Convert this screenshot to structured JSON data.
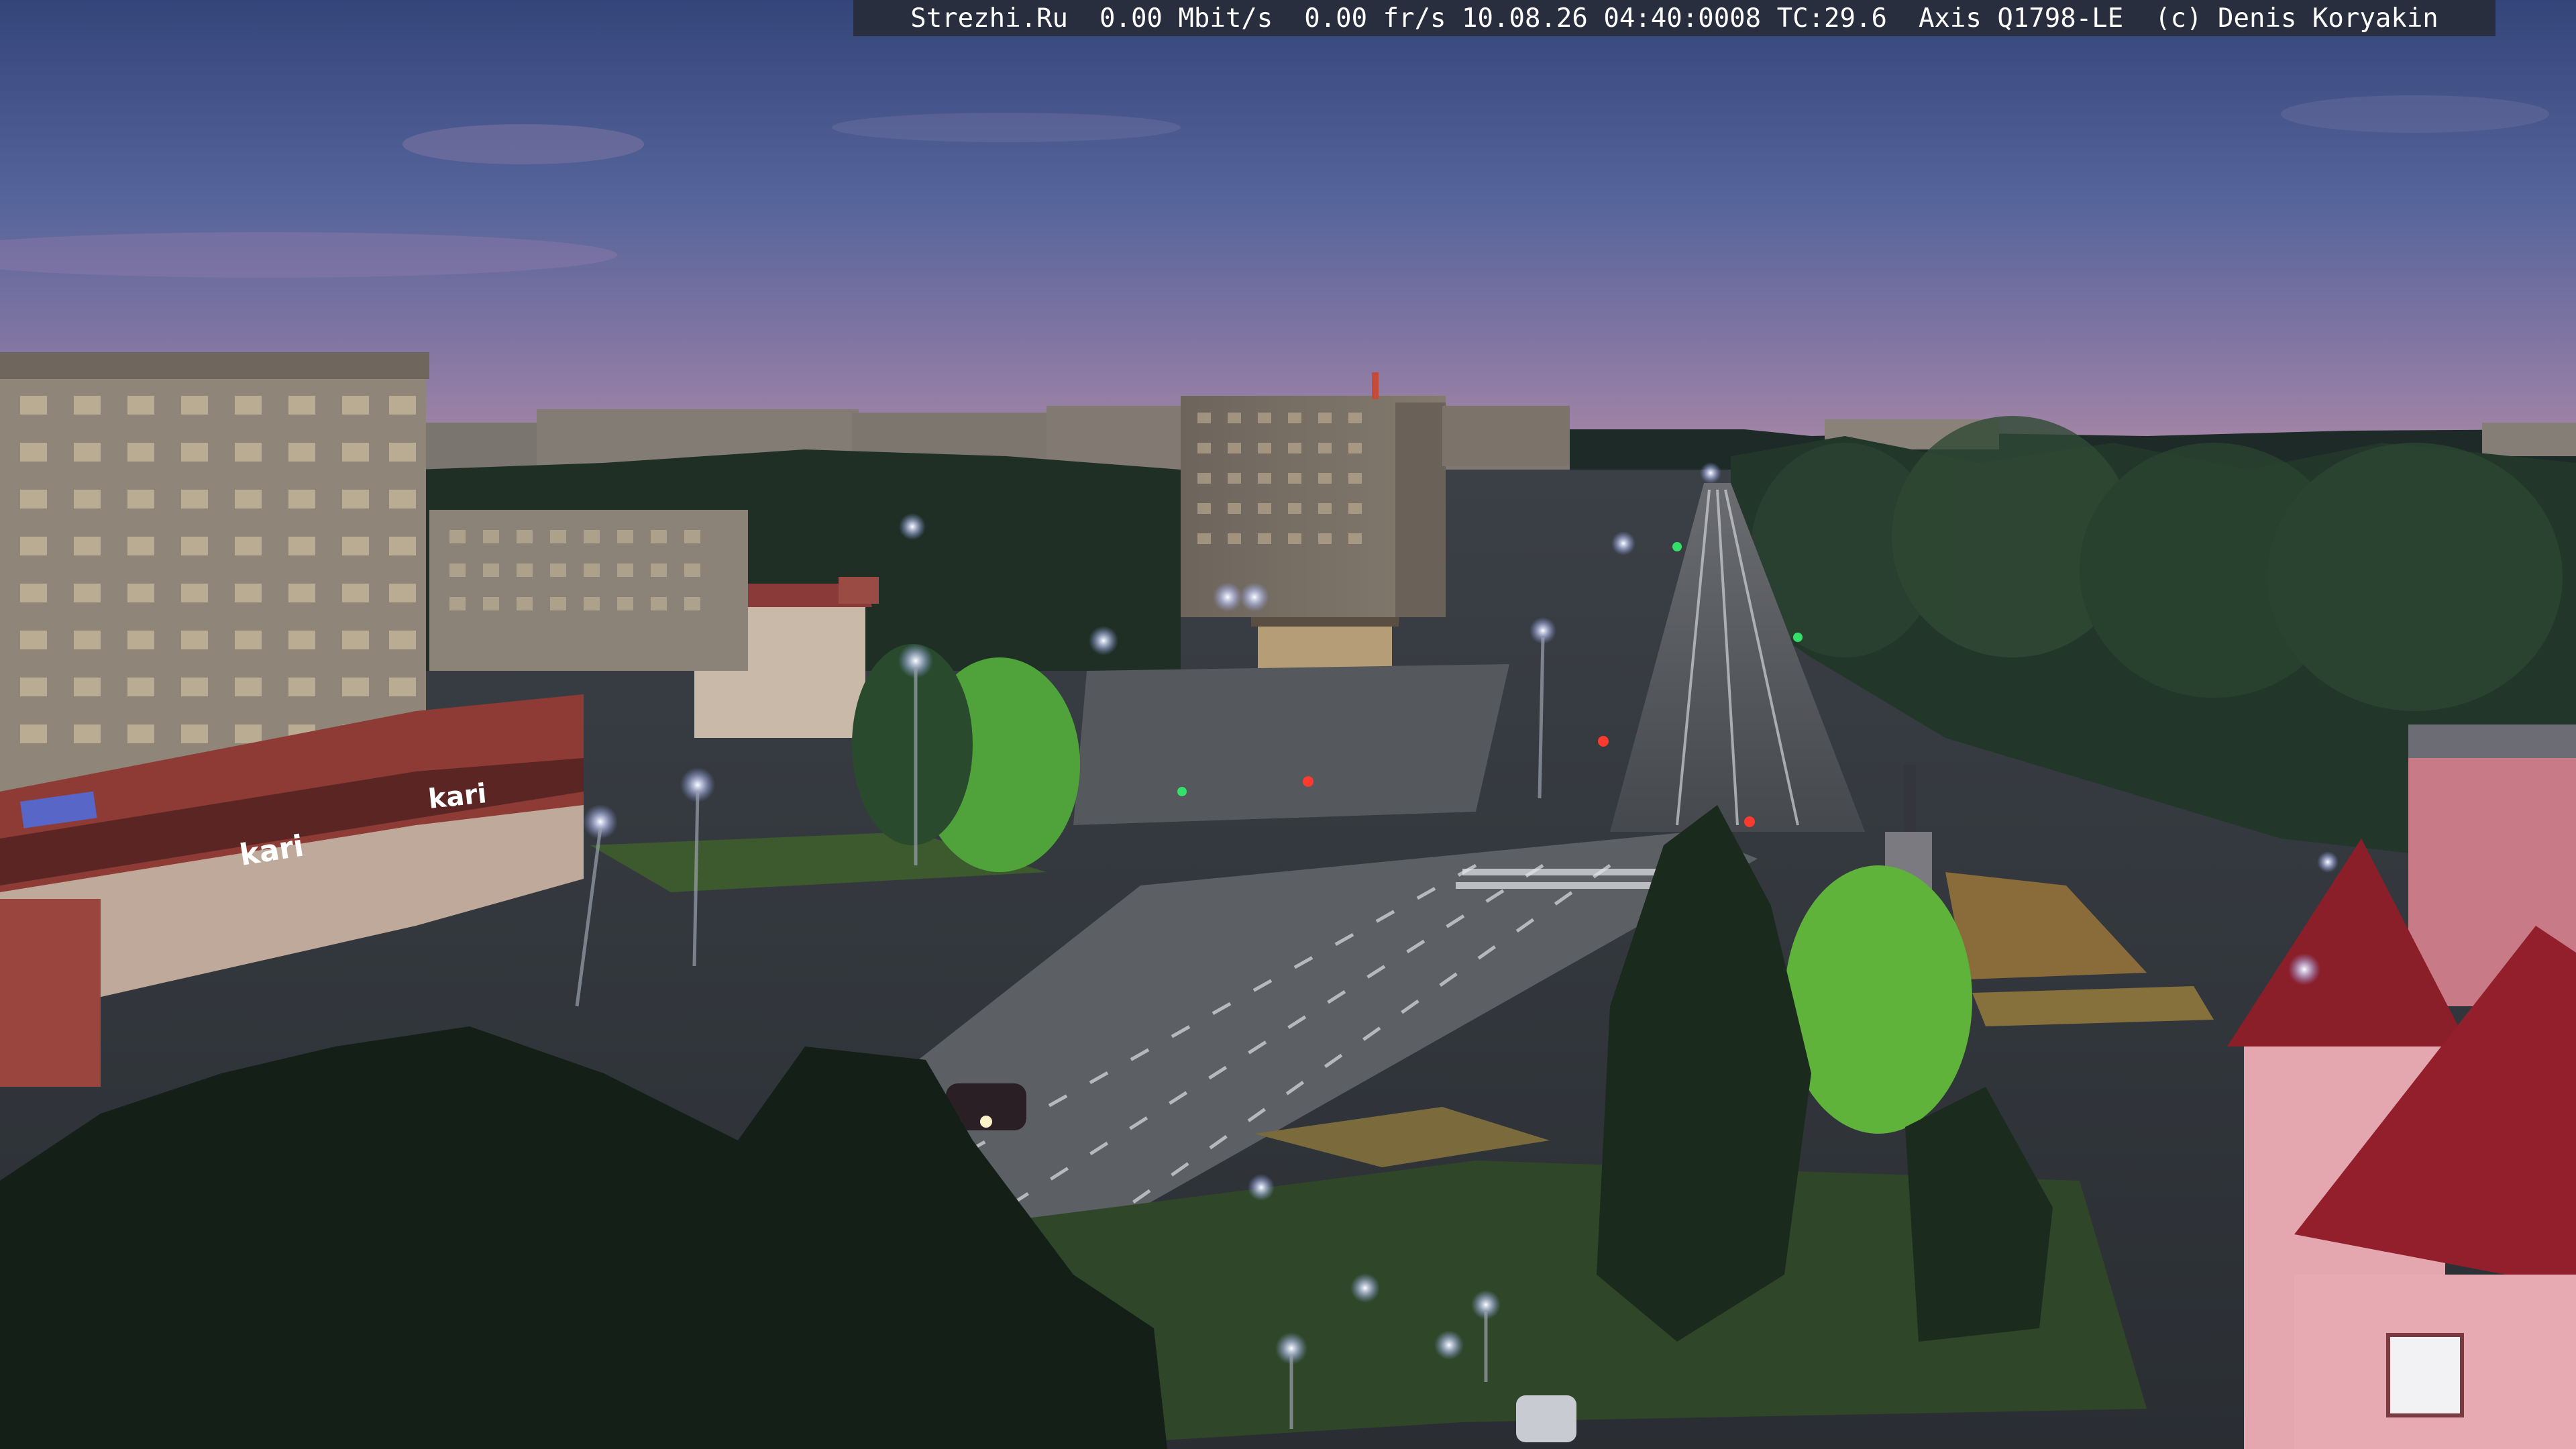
{
  "overlay": {
    "text": "Strezhi.Ru  0.00 Mbit/s  0.00 fr/s 10.08.26 04:40:0008 TC:29.6  Axis Q1798-LE  (c) Denis Koryakin"
  },
  "storefront": {
    "sign_left": "kari",
    "sign_right": "kari"
  },
  "colors": {
    "sky_top": "#3a4a78",
    "sky_mid": "#5f6696",
    "sky_horizon": "#9a7aa0",
    "street_light": "#dfe6ff",
    "tree_dark": "#18261d",
    "tree_lit": "#5fb33a",
    "asphalt": "#4a4d52",
    "brick_red": "#8e3b36"
  }
}
